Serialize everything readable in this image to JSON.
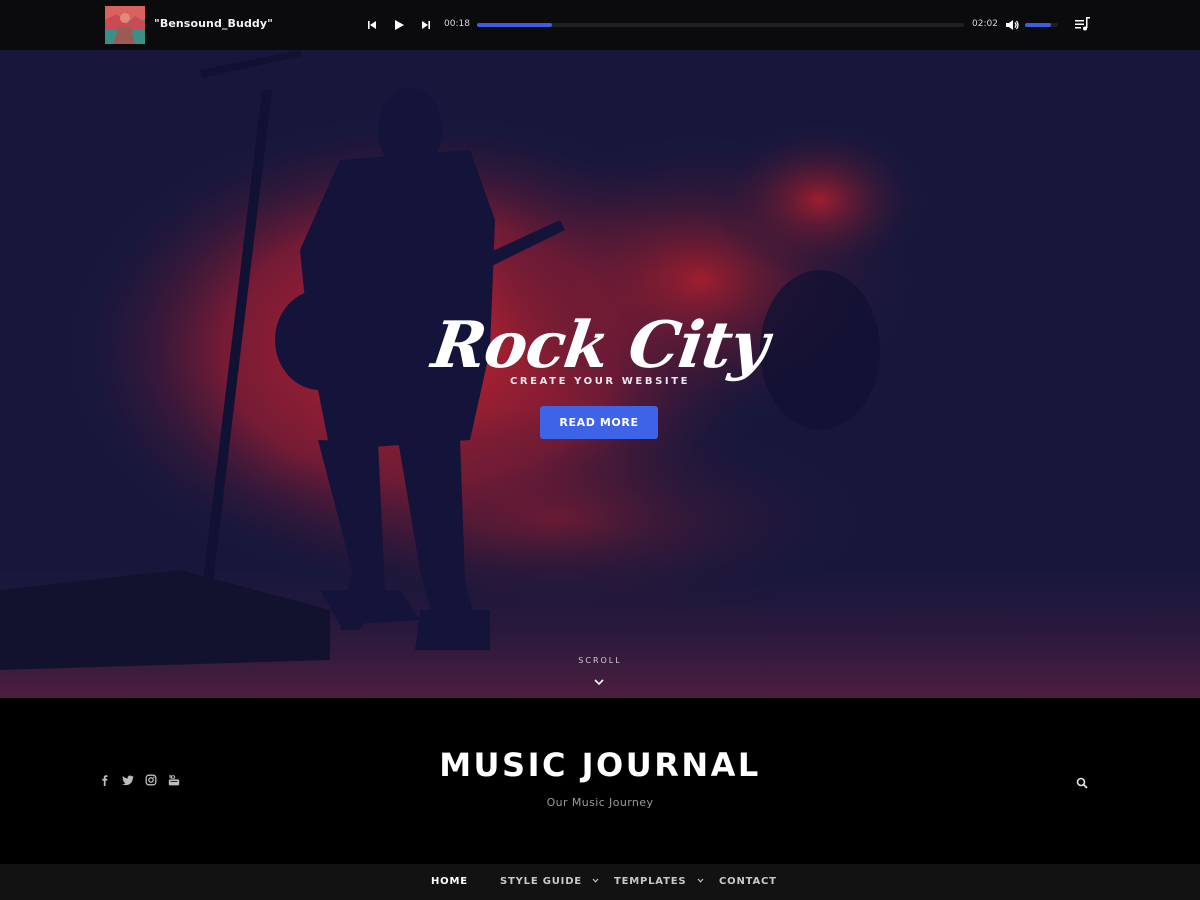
{
  "player": {
    "track_title": "\"Bensound_Buddy\"",
    "current_time": "00:18",
    "total_time": "02:02",
    "progress_fraction": 0.154,
    "volume_fraction": 0.8,
    "icons": [
      "album-art",
      "previous-icon",
      "play-icon",
      "next-icon",
      "volume-icon",
      "playlist-icon"
    ],
    "accent_color": "#3e5ce4"
  },
  "hero": {
    "title": "Rock City",
    "subtitle": "CREATE YOUR WEBSITE",
    "button_label": "READ MORE",
    "scroll_label": "SCROLL",
    "button_color": "#3f63e6"
  },
  "header": {
    "site_title": "MUSIC JOURNAL",
    "tagline": "Our Music Journey",
    "social_icons": [
      "facebook-icon",
      "twitter-icon",
      "instagram-icon",
      "youtube-icon"
    ],
    "search_icon": "search-icon"
  },
  "nav": {
    "items": [
      {
        "label": "HOME",
        "active": true,
        "has_dropdown": false
      },
      {
        "label": "STYLE GUIDE",
        "active": false,
        "has_dropdown": true
      },
      {
        "label": "TEMPLATES",
        "active": false,
        "has_dropdown": true
      },
      {
        "label": "CONTACT",
        "active": false,
        "has_dropdown": false
      }
    ]
  }
}
